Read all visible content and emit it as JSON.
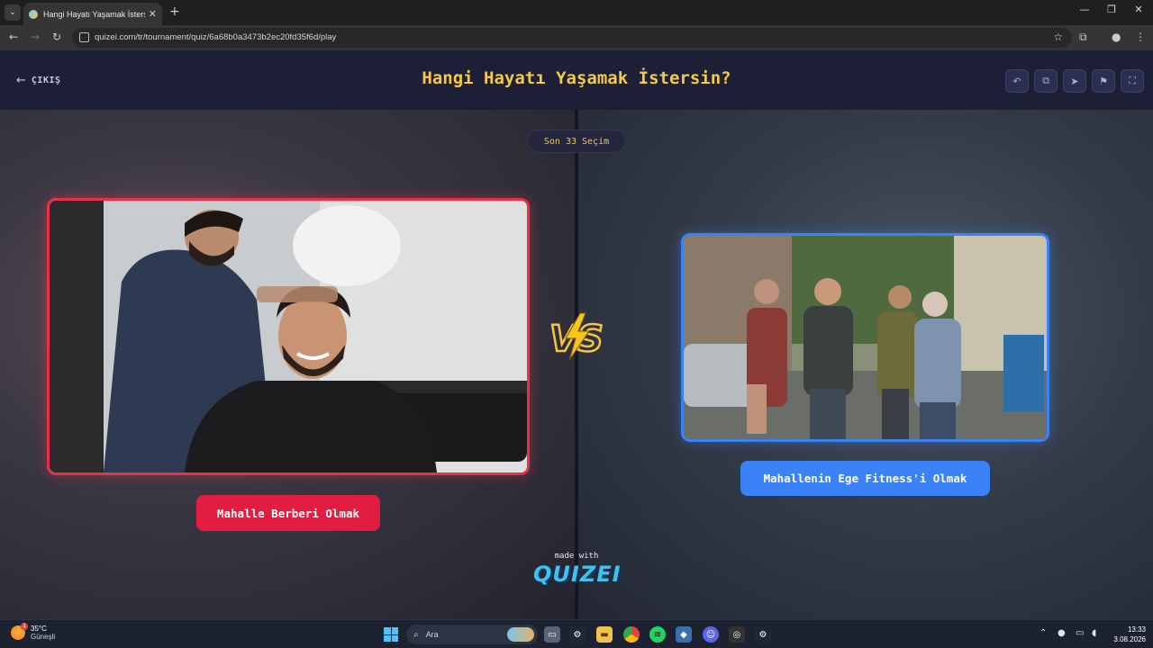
{
  "browser": {
    "tab_title": "Hangi Hayatı Yaşamak İstersin?",
    "tab_close": "✕",
    "new_tab": "+",
    "url": "quizei.com/tr/tournament/quiz/6a68b0a3473b2ec20fd35f6d/play"
  },
  "header": {
    "exit_label": "ÇIKIŞ",
    "title": "Hangi Hayatı Yaşamak İstersin?",
    "tools": [
      "undo-icon",
      "share-icon",
      "send-icon",
      "flag-icon",
      "fullscreen-icon"
    ]
  },
  "round": {
    "label": "Son 33 Seçim"
  },
  "options": {
    "left_label": "Mahalle Berberi Olmak",
    "right_label": "Mahallenin Ege Fitness'i Olmak",
    "left_color": "#e21d40",
    "right_color": "#3b82f6"
  },
  "vs_icon": "vs-lightning-icon",
  "footer": {
    "made_with": "made with",
    "brand": "QUIZEI"
  },
  "taskbar": {
    "weather_temp": "35°C",
    "weather_condition": "Güneşli",
    "weather_badge": "1",
    "search_label": "Ara",
    "time": "13:33",
    "date": "3.08.2026"
  },
  "colors": {
    "title_yellow": "#f3c84b",
    "topbar": "#1c1f36"
  }
}
